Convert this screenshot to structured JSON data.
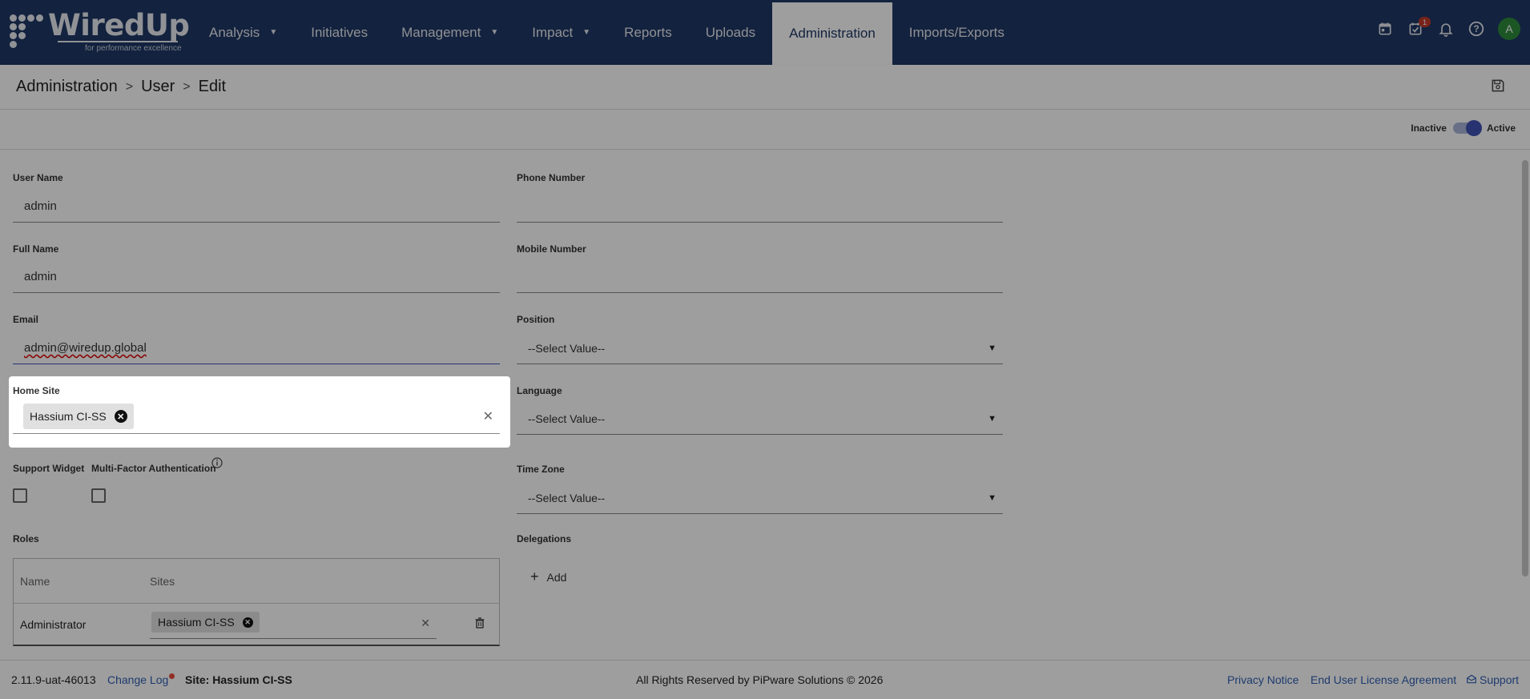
{
  "brand": {
    "name": "WiredUp",
    "tagline": "for performance excellence"
  },
  "nav": {
    "items": [
      {
        "label": "Analysis",
        "caret": true
      },
      {
        "label": "Initiatives",
        "caret": false
      },
      {
        "label": "Management",
        "caret": true
      },
      {
        "label": "Impact",
        "caret": true
      },
      {
        "label": "Reports",
        "caret": false
      },
      {
        "label": "Uploads",
        "caret": false
      },
      {
        "label": "Administration",
        "caret": false,
        "active": true
      },
      {
        "label": "Imports/Exports",
        "caret": false
      }
    ],
    "tasks_badge": "1",
    "avatar_initial": "A"
  },
  "breadcrumb": {
    "items": [
      "Administration",
      "User",
      "Edit"
    ]
  },
  "status": {
    "inactive_label": "Inactive",
    "active_label": "Active",
    "is_active": true
  },
  "form": {
    "user_name": {
      "label": "User Name",
      "value": "admin"
    },
    "full_name": {
      "label": "Full Name",
      "value": "admin"
    },
    "email": {
      "label": "Email",
      "value": "admin@wiredup.global"
    },
    "home_site": {
      "label": "Home Site",
      "chip": "Hassium CI-SS"
    },
    "support_widget": {
      "label": "Support Widget",
      "checked": false
    },
    "mfa": {
      "label": "Multi-Factor Authentication",
      "checked": false
    },
    "phone": {
      "label": "Phone Number",
      "value": ""
    },
    "mobile": {
      "label": "Mobile Number",
      "value": ""
    },
    "position": {
      "label": "Position",
      "value": "--Select Value--"
    },
    "language": {
      "label": "Language",
      "value": "--Select Value--"
    },
    "timezone": {
      "label": "Time Zone",
      "value": "--Select Value--"
    }
  },
  "roles": {
    "label": "Roles",
    "columns": [
      "Name",
      "Sites"
    ],
    "rows": [
      {
        "name": "Administrator",
        "site_chip": "Hassium CI-SS"
      }
    ]
  },
  "delegations": {
    "label": "Delegations",
    "add_label": "Add"
  },
  "footer": {
    "version": "2.11.9-uat-46013",
    "changelog": "Change Log",
    "site": "Site: Hassium CI-SS",
    "copyright": "All Rights Reserved by PiPware Solutions © 2026",
    "privacy": "Privacy Notice",
    "eula": "End User License Agreement",
    "support": "Support"
  }
}
